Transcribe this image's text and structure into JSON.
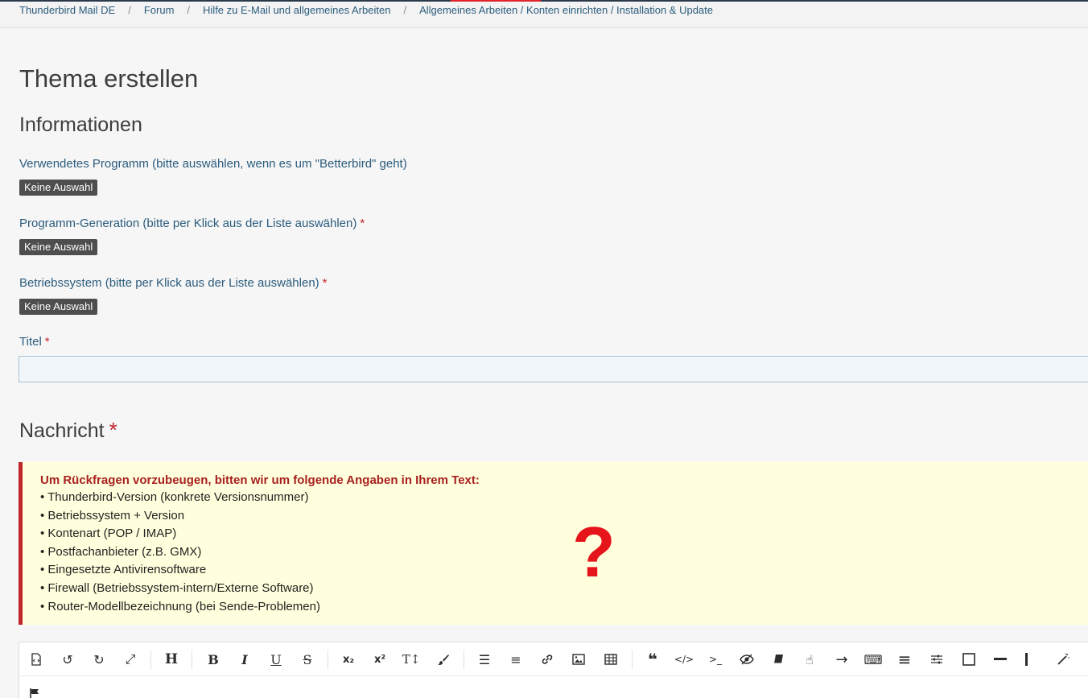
{
  "breadcrumb": {
    "items": [
      "Thunderbird Mail DE",
      "Forum",
      "Hilfe zu E-Mail und allgemeines Arbeiten",
      "Allgemeines Arbeiten / Konten einrichten / Installation & Update"
    ],
    "separator": "/"
  },
  "page": {
    "title": "Thema erstellen",
    "section_title": "Informationen"
  },
  "fields": {
    "program": {
      "label": "Verwendetes Programm (bitte auswählen, wenn es um \"Betterbird\" geht)",
      "value": "Keine Auswahl"
    },
    "generation": {
      "label": "Programm-Generation (bitte per Klick aus der Liste auswählen)",
      "required_mark": "*",
      "value": "Keine Auswahl"
    },
    "os": {
      "label": "Betriebssystem (bitte per Klick aus der Liste auswählen)",
      "required_mark": "*",
      "value": "Keine Auswahl"
    },
    "title": {
      "label": "Titel",
      "required_mark": "*",
      "value": ""
    }
  },
  "message": {
    "title": "Nachricht",
    "required_mark": "*",
    "notice_heading": "Um Rückfragen vorzubeugen, bitten wir um folgende Angaben in Ihrem Text:",
    "notice_items": [
      "• Thunderbird-Version (konkrete Versionsnummer)",
      "• Betriebssystem + Version",
      "• Kontenart (POP / IMAP)",
      "• Postfachanbieter (z.B. GMX)",
      "• Eingesetzte Antivirensoftware",
      "• Firewall (Betriebssystem-intern/Externe Software)",
      "• Router-Modellbezeichnung (bei Sende-Problemen)"
    ],
    "notice_mark": "?"
  },
  "toolbar": {
    "buttons": [
      {
        "name": "source-code-icon",
        "glyph": ""
      },
      {
        "name": "undo-icon",
        "glyph": "↺"
      },
      {
        "name": "redo-icon",
        "glyph": "↻"
      },
      {
        "name": "fullscreen-icon",
        "glyph": "⤢"
      },
      {
        "name": "heading-icon",
        "glyph": "H"
      },
      {
        "name": "bold-icon",
        "glyph": "B"
      },
      {
        "name": "italic-icon",
        "glyph": "I"
      },
      {
        "name": "underline-icon",
        "glyph": "U"
      },
      {
        "name": "strikethrough-icon",
        "glyph": "S"
      },
      {
        "name": "subscript-icon",
        "glyph": "x₂"
      },
      {
        "name": "superscript-icon",
        "glyph": "x²"
      },
      {
        "name": "font-size-icon",
        "glyph": "T↕"
      },
      {
        "name": "paintbrush-icon",
        "glyph": "🖌"
      },
      {
        "name": "list-icon",
        "glyph": "☰"
      },
      {
        "name": "align-icon",
        "glyph": "≡"
      },
      {
        "name": "link-icon",
        "glyph": "🔗"
      },
      {
        "name": "image-icon",
        "glyph": "▣"
      },
      {
        "name": "table-icon",
        "glyph": "⊞"
      },
      {
        "name": "quote-icon",
        "glyph": "❝"
      },
      {
        "name": "code-icon",
        "glyph": "</>"
      },
      {
        "name": "terminal-icon",
        "glyph": ">_"
      },
      {
        "name": "spoiler-icon",
        "glyph": "◉"
      },
      {
        "name": "book-icon",
        "glyph": "▰"
      },
      {
        "name": "pointer-hand-icon",
        "glyph": "☝"
      },
      {
        "name": "arrow-right-icon",
        "glyph": "→"
      },
      {
        "name": "keyboard-icon",
        "glyph": "⌨"
      },
      {
        "name": "menu-icon",
        "glyph": "≡"
      },
      {
        "name": "sliders-icon",
        "glyph": "⚌"
      },
      {
        "name": "square-icon",
        "glyph": "☐"
      },
      {
        "name": "horizontal-line-icon",
        "glyph": "━"
      },
      {
        "name": "vertical-line-icon",
        "glyph": "┃"
      },
      {
        "name": "magic-wand-icon",
        "glyph": "⁄"
      }
    ]
  },
  "editor": {
    "body_icon": "flag-icon"
  }
}
